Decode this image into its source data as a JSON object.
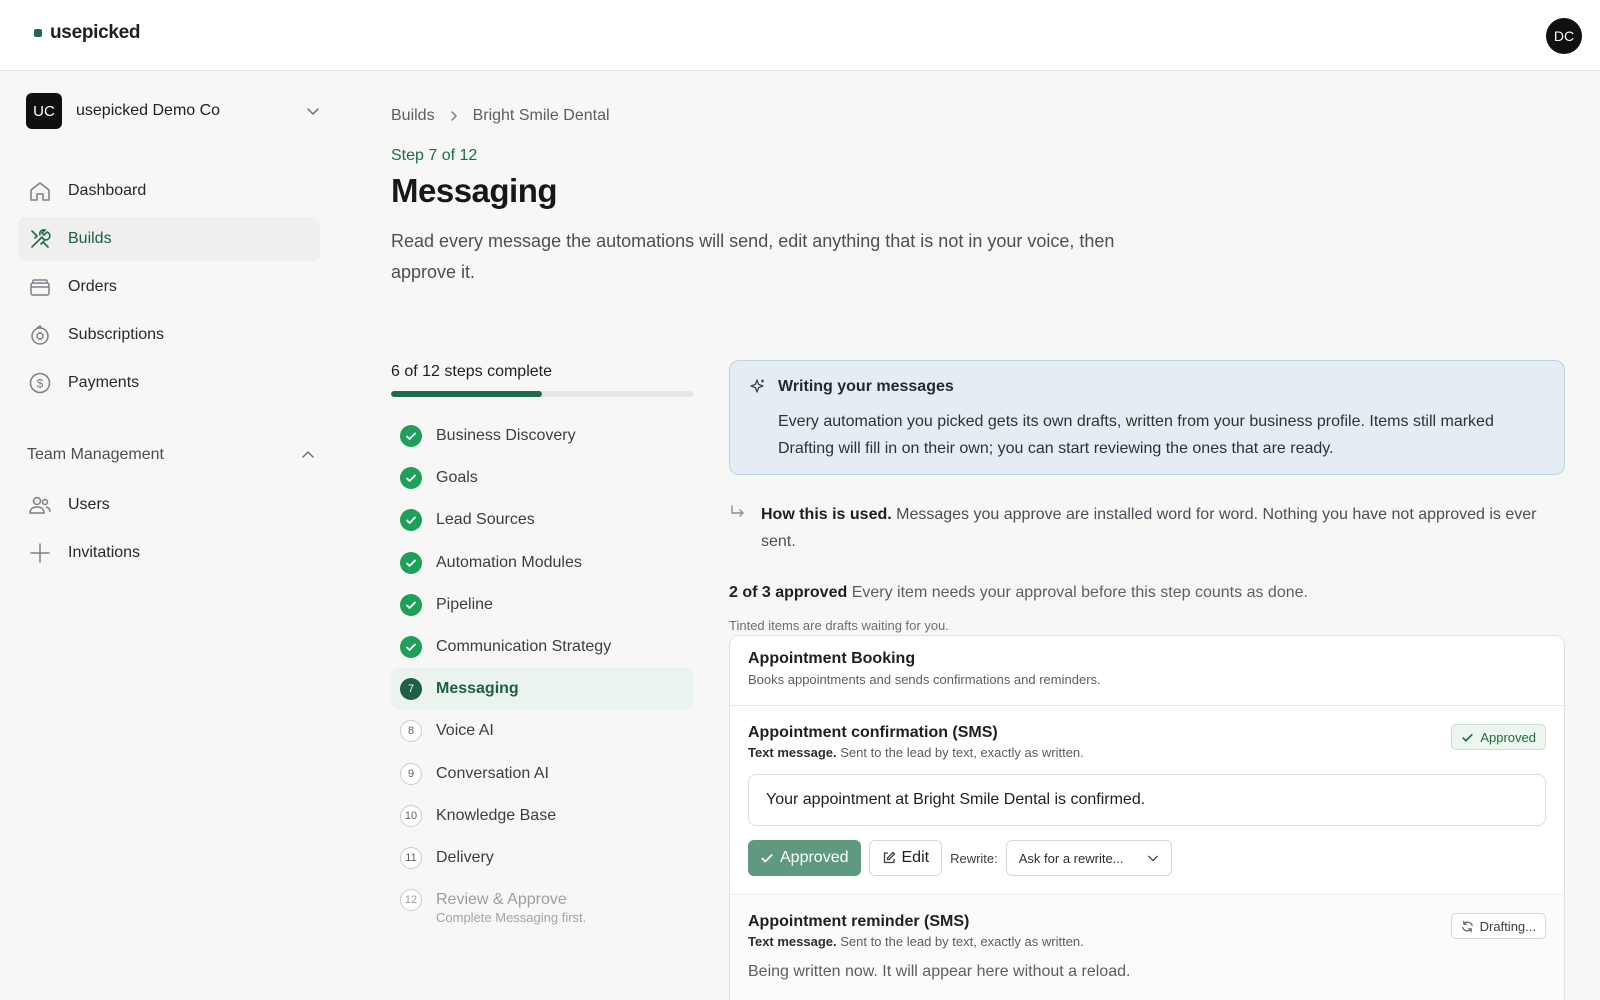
{
  "app": {
    "brand": "usepicked",
    "user_initials": "DC"
  },
  "sidebar": {
    "org": {
      "initials": "UC",
      "name": "usepicked Demo Co"
    },
    "items": [
      {
        "label": "Dashboard",
        "icon": "home-icon"
      },
      {
        "label": "Builds",
        "icon": "tools-icon",
        "active": true
      },
      {
        "label": "Orders",
        "icon": "box-icon"
      },
      {
        "label": "Subscriptions",
        "icon": "recurring-icon"
      },
      {
        "label": "Payments",
        "icon": "dollar-icon"
      }
    ],
    "team_section": {
      "label": "Team Management",
      "items": [
        {
          "label": "Users",
          "icon": "users-icon"
        },
        {
          "label": "Invitations",
          "icon": "plus-icon"
        }
      ]
    }
  },
  "breadcrumb": {
    "root": "Builds",
    "current": "Bright Smile Dental"
  },
  "page": {
    "step_label": "Step 7 of 12",
    "title": "Messaging",
    "description": "Read every message the automations will send, edit anything that is not in your voice, then approve it."
  },
  "progress": {
    "label": "6 of 12 steps complete",
    "fraction": 0.5,
    "steps": [
      {
        "label": "Business Discovery",
        "status": "done"
      },
      {
        "label": "Goals",
        "status": "done"
      },
      {
        "label": "Lead Sources",
        "status": "done"
      },
      {
        "label": "Automation Modules",
        "status": "done"
      },
      {
        "label": "Pipeline",
        "status": "done"
      },
      {
        "label": "Communication Strategy",
        "status": "done"
      },
      {
        "label": "Messaging",
        "status": "current",
        "number": "7"
      },
      {
        "label": "Voice AI",
        "status": "todo",
        "number": "8"
      },
      {
        "label": "Conversation AI",
        "status": "todo",
        "number": "9"
      },
      {
        "label": "Knowledge Base",
        "status": "todo",
        "number": "10"
      },
      {
        "label": "Delivery",
        "status": "todo",
        "number": "11"
      },
      {
        "label": "Review & Approve",
        "status": "disabled",
        "number": "12",
        "sub": "Complete Messaging first."
      }
    ]
  },
  "info": {
    "title": "Writing your messages",
    "body": "Every automation you picked gets its own drafts, written from your business profile. Items still marked Drafting will fill in on their own; you can start reviewing the ones that are ready."
  },
  "howto": {
    "lead": "How this is used.",
    "text": " Messages you approve are installed word for word. Nothing you have not approved is ever sent."
  },
  "approval": {
    "count": "2 of 3 approved",
    "text": " Every item needs your approval before this step counts as done.",
    "tinted_note": "Tinted items are drafts waiting for you."
  },
  "module": {
    "title": "Appointment Booking",
    "desc": "Books appointments and sends confirmations and reminders.",
    "messages": [
      {
        "title": "Appointment confirmation (SMS)",
        "channel": "Text message.",
        "meta": " Sent to the lead by text, exactly as written.",
        "badge": "Approved",
        "body": "Your appointment at Bright Smile Dental is confirmed.",
        "approve_label": "Approved",
        "edit_label": "Edit",
        "rewrite_label": "Rewrite:",
        "rewrite_placeholder": "Ask for a rewrite..."
      },
      {
        "title": "Appointment reminder (SMS)",
        "channel": "Text message.",
        "meta": " Sent to the lead by text, exactly as written.",
        "badge": "Drafting...",
        "body": "Being written now. It will appear here without a reload."
      }
    ]
  },
  "colors": {
    "accent": "#1f6b4c",
    "done": "#1fa05a",
    "info_bg": "#e4edf4"
  }
}
